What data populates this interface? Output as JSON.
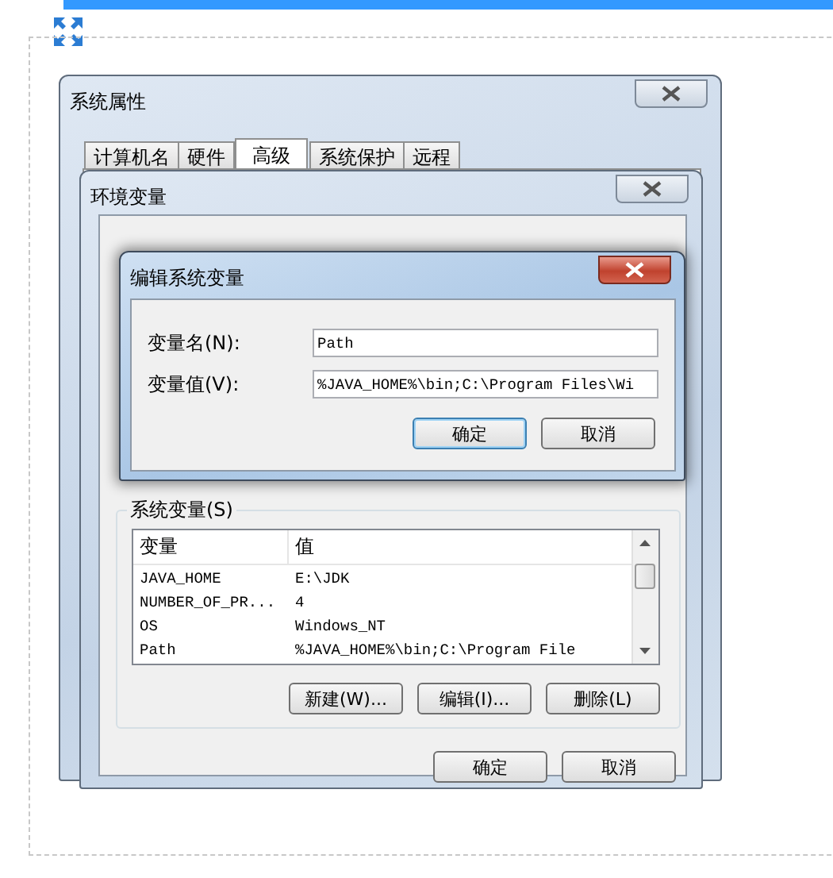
{
  "system_properties": {
    "title": "系统属性",
    "tabs": [
      {
        "label": "计算机名",
        "selected": false
      },
      {
        "label": "硬件",
        "selected": false
      },
      {
        "label": "高级",
        "selected": true
      },
      {
        "label": "系统保护",
        "selected": false
      },
      {
        "label": "远程",
        "selected": false
      }
    ]
  },
  "environment_variables": {
    "title": "环境变量",
    "system_variables": {
      "label": "系统变量(S)",
      "columns": [
        "变量",
        "值"
      ],
      "rows": [
        {
          "name": "JAVA_HOME",
          "value": "E:\\JDK"
        },
        {
          "name": "NUMBER_OF_PR...",
          "value": "4"
        },
        {
          "name": "OS",
          "value": "Windows_NT"
        },
        {
          "name": "Path",
          "value": "%JAVA_HOME%\\bin;C:\\Program File"
        }
      ],
      "buttons": [
        "新建(W)...",
        "编辑(I)...",
        "删除(L)"
      ]
    },
    "buttons": [
      "确定",
      "取消"
    ]
  },
  "edit_dialog": {
    "title": "编辑系统变量",
    "fields": [
      {
        "label": "变量名(N):",
        "value": "Path"
      },
      {
        "label": "变量值(V):",
        "value": "%JAVA_HOME%\\bin;C:\\Program Files\\Wi"
      }
    ],
    "buttons": [
      {
        "label": "确定",
        "default": true
      },
      {
        "label": "取消",
        "default": false
      }
    ]
  }
}
